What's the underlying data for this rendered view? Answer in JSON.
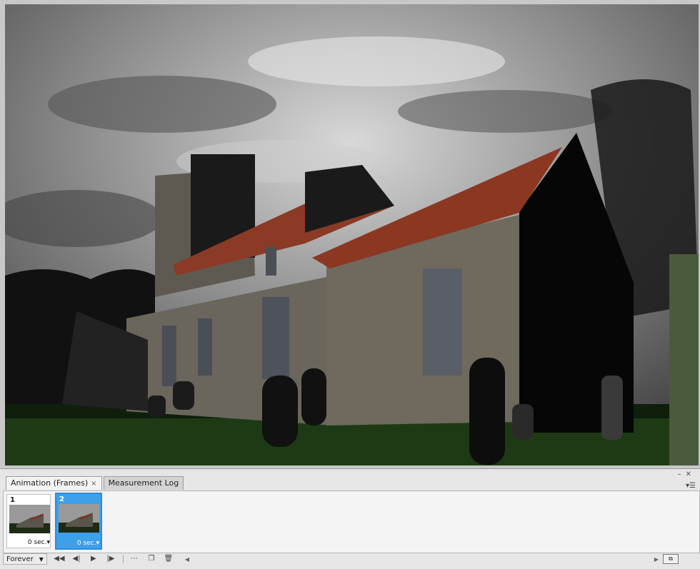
{
  "tabs": [
    {
      "label": "Animation (Frames)",
      "close": "×"
    },
    {
      "label": "Measurement Log"
    }
  ],
  "frames": [
    {
      "number": "1",
      "delay": "0 sec."
    },
    {
      "number": "2",
      "delay": "0 sec."
    }
  ],
  "toolbar": {
    "loop_option": "Forever"
  },
  "colors": {
    "selected_frame": "#3fa0ea",
    "panel_bg": "#e6e6e6"
  },
  "icons": {
    "rewind": "first-frame-icon",
    "previous": "previous-frame-icon",
    "play": "play-icon",
    "next": "next-frame-icon",
    "tween": "tween-icon",
    "duplicate": "duplicate-frame-icon",
    "delete": "trash-icon"
  }
}
